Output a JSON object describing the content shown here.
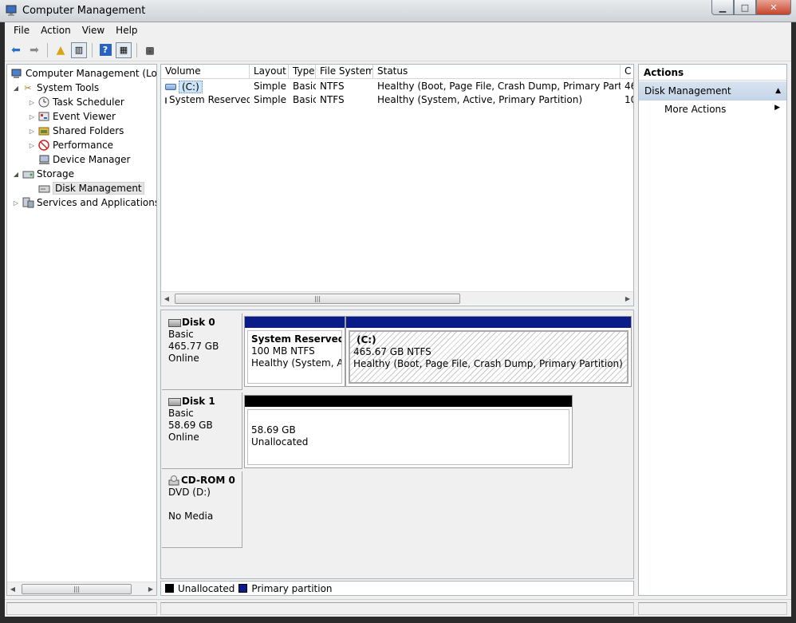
{
  "window": {
    "title": "Computer Management"
  },
  "menu": [
    "File",
    "Action",
    "View",
    "Help"
  ],
  "tree": [
    {
      "label": "Computer Management (Local",
      "arrow": "",
      "icon": "computer-management-icon",
      "glyph": "🖳",
      "level": 0
    },
    {
      "label": "System Tools",
      "arrow": "◢",
      "icon": "system-tools-icon",
      "glyph": "🛠",
      "level": 1
    },
    {
      "label": "Task Scheduler",
      "arrow": "▷",
      "icon": "task-scheduler-icon",
      "glyph": "◷",
      "level": 2
    },
    {
      "label": "Event Viewer",
      "arrow": "▷",
      "icon": "event-viewer-icon",
      "glyph": "▤",
      "level": 2
    },
    {
      "label": "Shared Folders",
      "arrow": "▷",
      "icon": "shared-folders-icon",
      "glyph": "▰",
      "level": 2
    },
    {
      "label": "Performance",
      "arrow": "▷",
      "icon": "performance-icon",
      "glyph": "⊘",
      "level": 2
    },
    {
      "label": "Device Manager",
      "arrow": "",
      "icon": "device-manager-icon",
      "glyph": "🖳",
      "level": 2
    },
    {
      "label": "Storage",
      "arrow": "◢",
      "icon": "storage-icon",
      "glyph": "▭",
      "level": 1
    },
    {
      "label": "Disk Management",
      "arrow": "",
      "icon": "disk-management-icon",
      "glyph": "▭",
      "level": 2,
      "selected": true
    },
    {
      "label": "Services and Applications",
      "arrow": "▷",
      "icon": "services-icon",
      "glyph": "▦",
      "level": 1
    }
  ],
  "columns": [
    "Volume",
    "Layout",
    "Type",
    "File System",
    "Status",
    "C"
  ],
  "volumes": [
    {
      "volume": "(C:)",
      "layout": "Simple",
      "type": "Basic",
      "fs": "NTFS",
      "status": "Healthy (Boot, Page File, Crash Dump, Primary Partition)",
      "cap": "46"
    },
    {
      "volume": "System Reserved",
      "layout": "Simple",
      "type": "Basic",
      "fs": "NTFS",
      "status": "Healthy (System, Active, Primary Partition)",
      "cap": "10"
    }
  ],
  "disks": {
    "disk0": {
      "name": "Disk 0",
      "type": "Basic",
      "size": "465.77 GB",
      "state": "Online"
    },
    "disk1": {
      "name": "Disk 1",
      "type": "Basic",
      "size": "58.69 GB",
      "state": "Online"
    },
    "cdrom0": {
      "name": "CD-ROM 0",
      "type": "DVD (D:)",
      "size": "",
      "state": "No Media"
    }
  },
  "partitions": {
    "sysres": {
      "name": "System Reserved",
      "size": "100 MB NTFS",
      "status": "Healthy (System, Act"
    },
    "c": {
      "name": "(C:)",
      "size": "465.67 GB NTFS",
      "status": "Healthy (Boot, Page File, Crash Dump, Primary Partition)"
    },
    "unalloc": {
      "size": "58.69 GB",
      "status": "Unallocated"
    }
  },
  "legend": {
    "unallocated": "Unallocated",
    "primary": "Primary partition"
  },
  "colors": {
    "primary": "#0a1b8a",
    "unallocated": "#000000",
    "actions_header": "#c8d7ea"
  },
  "actions": {
    "title": "Actions",
    "section": "Disk Management",
    "more": "More Actions"
  }
}
